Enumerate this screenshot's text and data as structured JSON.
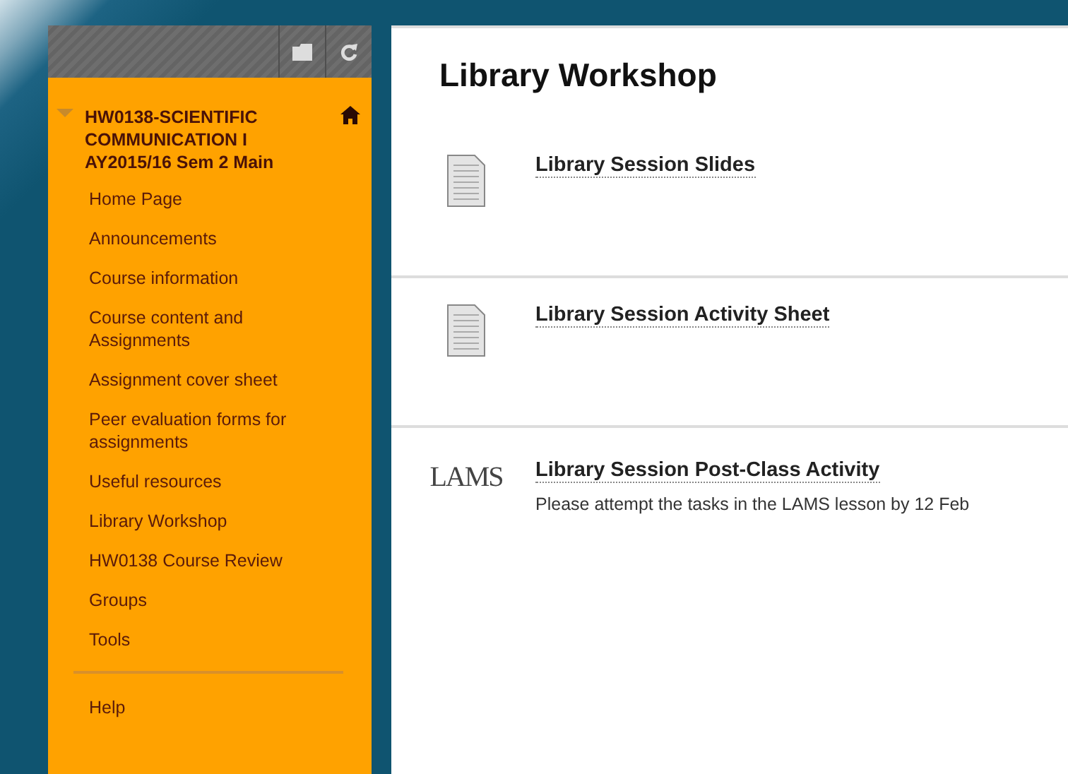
{
  "sidebar": {
    "course": {
      "title": "HW0138-SCIENTIFIC COMMUNICATION I AY2015/16 Sem 2 Main",
      "expanded": true
    },
    "items": [
      {
        "label": "Home Page"
      },
      {
        "label": "Announcements"
      },
      {
        "label": "Course information"
      },
      {
        "label": "Course content and Assignments"
      },
      {
        "label": "Assignment cover sheet"
      },
      {
        "label": "Peer evaluation forms for assignments"
      },
      {
        "label": "Useful resources"
      },
      {
        "label": "Library Workshop"
      },
      {
        "label": "HW0138 Course Review"
      },
      {
        "label": "Groups"
      },
      {
        "label": "Tools"
      }
    ],
    "footer_items": [
      {
        "label": "Help"
      }
    ]
  },
  "content": {
    "title": "Library Workshop",
    "items": [
      {
        "kind": "document",
        "title": "Library Session Slides"
      },
      {
        "kind": "document",
        "title": "Library Session Activity Sheet"
      },
      {
        "kind": "lams",
        "logo": "LAMS",
        "title": "Library Session Post-Class Activity",
        "description": "Please attempt the tasks in the LAMS lesson by 12 Feb"
      }
    ]
  }
}
